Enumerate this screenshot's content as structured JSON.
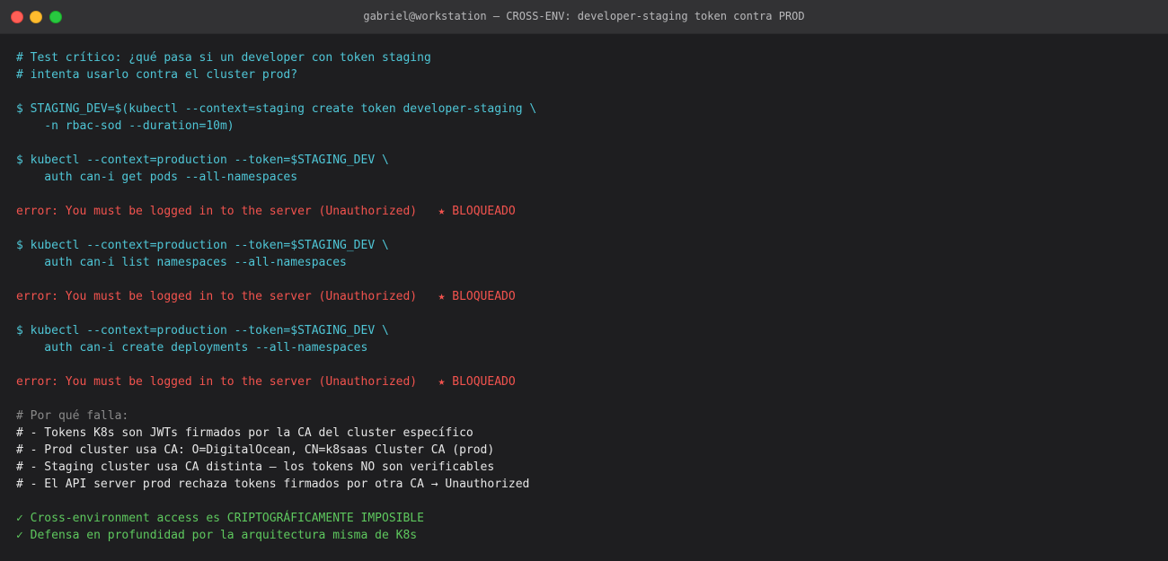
{
  "window": {
    "title": "gabriel@workstation — CROSS-ENV: developer-staging token contra PROD"
  },
  "terminal": {
    "lines": [
      {
        "text": "# Test crítico: ¿qué pasa si un developer con token staging",
        "color": "cyan"
      },
      {
        "text": "# intenta usarlo contra el cluster prod?",
        "color": "cyan"
      },
      {
        "text": "",
        "color": "cyan"
      },
      {
        "text": "$ STAGING_DEV=$(kubectl --context=staging create token developer-staging \\",
        "color": "cyan"
      },
      {
        "text": "    -n rbac-sod --duration=10m)",
        "color": "cyan"
      },
      {
        "text": "",
        "color": "cyan"
      },
      {
        "text": "$ kubectl --context=production --token=$STAGING_DEV \\",
        "color": "cyan"
      },
      {
        "text": "    auth can-i get pods --all-namespaces",
        "color": "cyan"
      },
      {
        "text": "",
        "color": "cyan"
      },
      {
        "text": "error: You must be logged in to the server (Unauthorized)   ★ BLOQUEADO",
        "color": "red"
      },
      {
        "text": "",
        "color": "cyan"
      },
      {
        "text": "$ kubectl --context=production --token=$STAGING_DEV \\",
        "color": "cyan"
      },
      {
        "text": "    auth can-i list namespaces --all-namespaces",
        "color": "cyan"
      },
      {
        "text": "",
        "color": "cyan"
      },
      {
        "text": "error: You must be logged in to the server (Unauthorized)   ★ BLOQUEADO",
        "color": "red"
      },
      {
        "text": "",
        "color": "cyan"
      },
      {
        "text": "$ kubectl --context=production --token=$STAGING_DEV \\",
        "color": "cyan"
      },
      {
        "text": "    auth can-i create deployments --all-namespaces",
        "color": "cyan"
      },
      {
        "text": "",
        "color": "cyan"
      },
      {
        "text": "error: You must be logged in to the server (Unauthorized)   ★ BLOQUEADO",
        "color": "red"
      },
      {
        "text": "",
        "color": "cyan"
      },
      {
        "text": "# Por qué falla:",
        "color": "gray"
      },
      {
        "text": "# - Tokens K8s son JWTs firmados por la CA del cluster específico",
        "color": "white"
      },
      {
        "text": "# - Prod cluster usa CA: O=DigitalOcean, CN=k8saas Cluster CA (prod)",
        "color": "white"
      },
      {
        "text": "# - Staging cluster usa CA distinta — los tokens NO son verificables",
        "color": "white"
      },
      {
        "text": "# - El API server prod rechaza tokens firmados por otra CA → Unauthorized",
        "color": "white"
      },
      {
        "text": "",
        "color": "cyan"
      },
      {
        "text": "✓ Cross-environment access es CRIPTOGRÁFICAMENTE IMPOSIBLE",
        "color": "green"
      },
      {
        "text": "✓ Defensa en profundidad por la arquitectura misma de K8s",
        "color": "green"
      }
    ]
  },
  "colors": {
    "cyan": "#4fc6d6",
    "red": "#f2534e",
    "gray": "#8a8a8a",
    "white": "#e6e6e6",
    "green": "#5ec85e",
    "background": "#1e1e20",
    "titlebar": "#323234"
  }
}
